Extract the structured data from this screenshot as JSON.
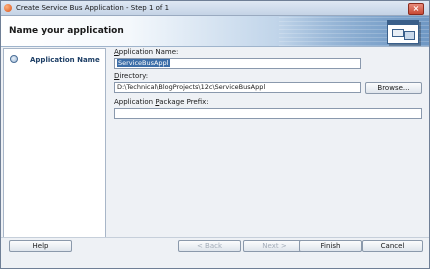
{
  "window": {
    "title": "Create Service Bus Application - Step 1 of 1",
    "close_label": "×"
  },
  "header": {
    "title": "Name your application",
    "icon": "application-wizard-icon"
  },
  "sidebar": {
    "items": [
      {
        "label": "Application Name",
        "icon": "step-circle-icon",
        "active": true
      }
    ]
  },
  "form": {
    "application_name": {
      "label_mnemonic": "A",
      "label_rest": "pplication Name:",
      "value": "ServiceBusAppl"
    },
    "directory": {
      "label_mnemonic": "D",
      "label_rest": "irectory:",
      "value": "D:\\Technical\\BlogProjects\\12c\\ServiceBusAppl",
      "browse_label": "Browse..."
    },
    "package_prefix": {
      "label_start": "Application ",
      "label_mnemonic": "P",
      "label_rest": "ackage Prefix:",
      "value": ""
    }
  },
  "footer": {
    "help_label": "Help",
    "back_label": "< Back",
    "next_label": "Next >",
    "finish_label": "Finish",
    "cancel_label": "Cancel"
  }
}
